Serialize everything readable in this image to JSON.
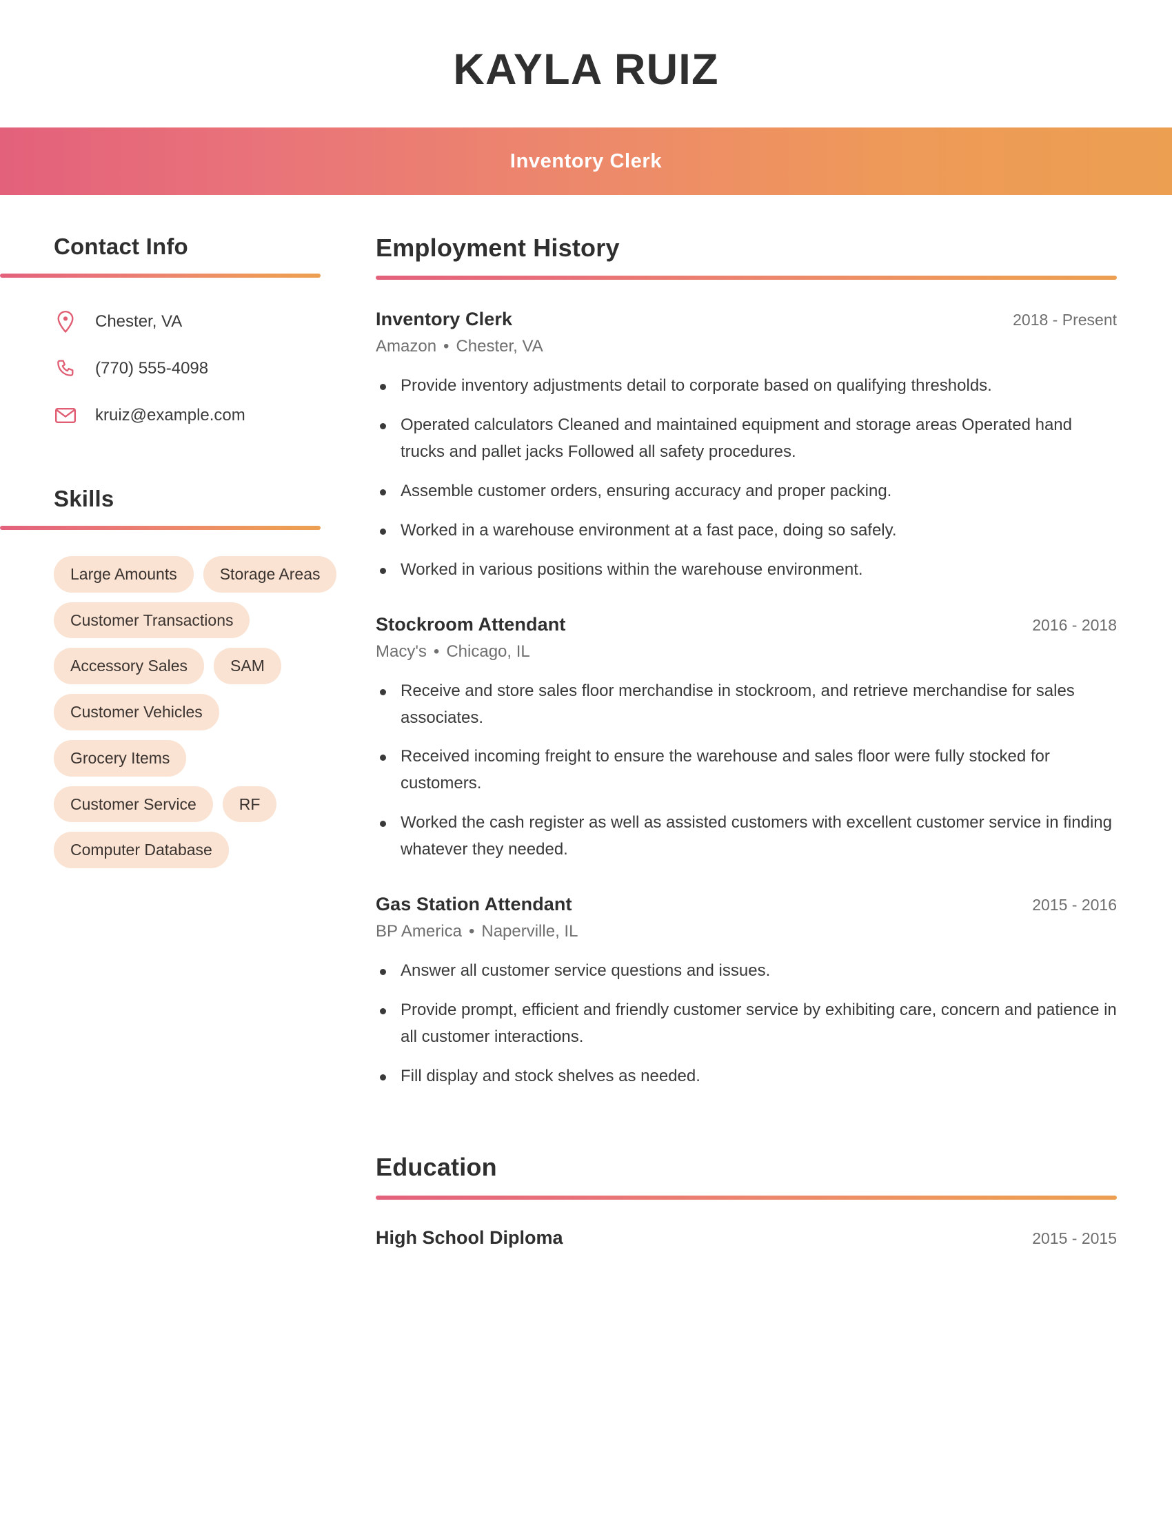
{
  "theme": {
    "gradient_start": "#E3617B",
    "gradient_end": "#EC9F51",
    "pill_background": "#FAE3D2",
    "heading_color": "#2F2F2F",
    "body_text_color": "#3A3A3A",
    "muted_text_color": "#6E6E6E",
    "page_background": "#FFFFFF"
  },
  "header": {
    "full_name": "KAYLA RUIZ",
    "job_title": "Inventory Clerk"
  },
  "sidebar": {
    "contact": {
      "heading": "Contact Info",
      "items": [
        {
          "icon": "location-pin-icon",
          "value": "Chester, VA"
        },
        {
          "icon": "phone-icon",
          "value": "(770) 555-4098"
        },
        {
          "icon": "envelope-icon",
          "value": "kruiz@example.com"
        }
      ]
    },
    "skills": {
      "heading": "Skills",
      "items": [
        "Large Amounts",
        "Storage Areas",
        "Customer Transactions",
        "Accessory Sales",
        "SAM",
        "Customer Vehicles",
        "Grocery Items",
        "Customer Service",
        "RF",
        "Computer Database"
      ]
    }
  },
  "main": {
    "employment": {
      "heading": "Employment History",
      "jobs": [
        {
          "role": "Inventory Clerk",
          "dates": "2018 - Present",
          "company": "Amazon",
          "location": "Chester, VA",
          "bullets": [
            "Provide inventory adjustments detail to corporate based on qualifying thresholds.",
            "Operated calculators Cleaned and maintained equipment and storage areas Operated hand trucks and pallet jacks Followed all safety procedures.",
            "Assemble customer orders, ensuring accuracy and proper packing.",
            "Worked in a warehouse environment at a fast pace, doing so safely.",
            "Worked in various positions within the warehouse environment."
          ]
        },
        {
          "role": "Stockroom Attendant",
          "dates": "2016 - 2018",
          "company": "Macy's",
          "location": "Chicago, IL",
          "bullets": [
            "Receive and store sales floor merchandise in stockroom, and retrieve merchandise for sales associates.",
            "Received incoming freight to ensure the warehouse and sales floor were fully stocked for customers.",
            "Worked the cash register as well as assisted customers with excellent customer service in finding whatever they needed."
          ]
        },
        {
          "role": "Gas Station Attendant",
          "dates": "2015 - 2016",
          "company": "BP America",
          "location": "Naperville, IL",
          "bullets": [
            "Answer all customer service questions and issues.",
            "Provide prompt, efficient and friendly customer service by exhibiting care, concern and patience in all customer interactions.",
            "Fill display and stock shelves as needed."
          ]
        }
      ]
    },
    "education": {
      "heading": "Education",
      "entries": [
        {
          "degree": "High School Diploma",
          "dates": "2015 - 2015"
        }
      ]
    }
  }
}
